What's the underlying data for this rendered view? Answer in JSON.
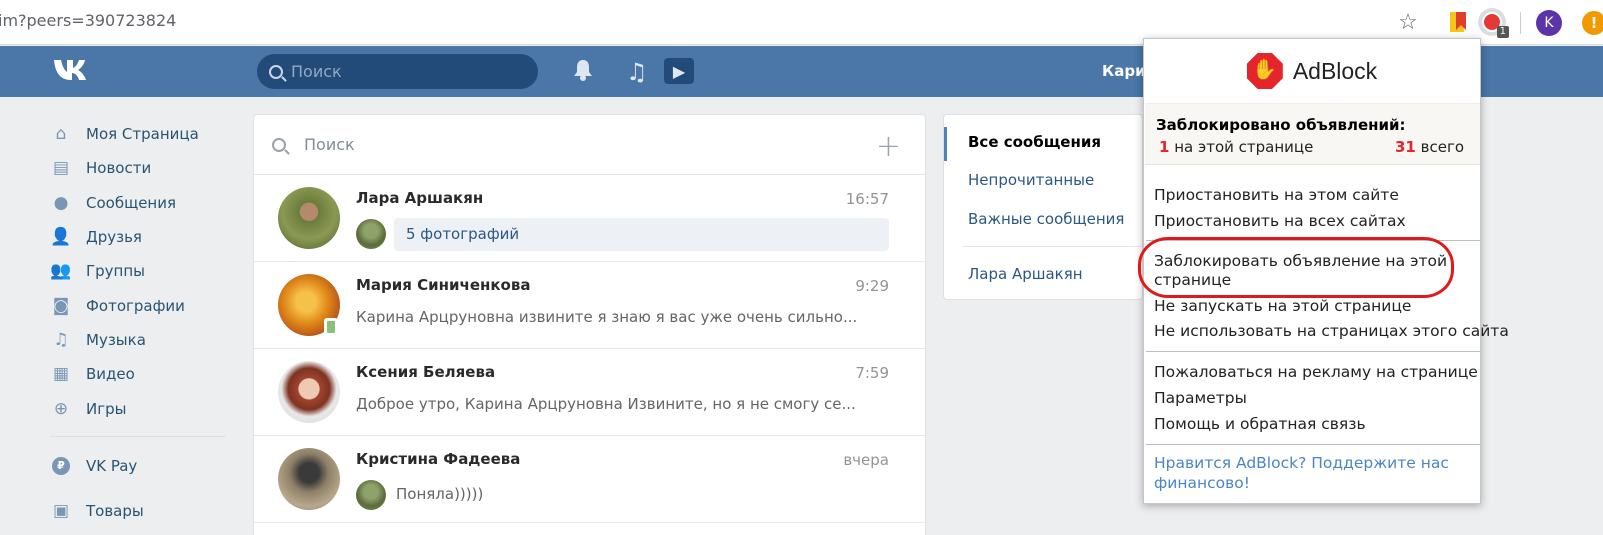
{
  "browser": {
    "url": "im?peers=390723824",
    "adblock_badge": "1",
    "profile_initial": "K",
    "alert_icon": "!"
  },
  "header": {
    "search_placeholder": "Поиск",
    "user_name": "Карин"
  },
  "left_menu": [
    {
      "label": "Моя Страница",
      "icon": "home-icon"
    },
    {
      "label": "Новости",
      "icon": "news-icon"
    },
    {
      "label": "Сообщения",
      "icon": "messages-icon"
    },
    {
      "label": "Друзья",
      "icon": "friends-icon"
    },
    {
      "label": "Группы",
      "icon": "groups-icon"
    },
    {
      "label": "Фотографии",
      "icon": "camera-icon"
    },
    {
      "label": "Музыка",
      "icon": "music-icon"
    },
    {
      "label": "Видео",
      "icon": "video-icon"
    },
    {
      "label": "Игры",
      "icon": "gamepad-icon"
    }
  ],
  "left_menu_extra": {
    "vkpay": "VK Pay",
    "vkpay_icon_letter": "₽",
    "goods": "Товары"
  },
  "dialogs": {
    "search_placeholder": "Поиск",
    "items": [
      {
        "name": "Лара Аршакян",
        "time": "16:57",
        "preview": "5 фотографий"
      },
      {
        "name": "Мария Синиченкова",
        "time": "9:29",
        "preview": "Карина Арцруновна извините я знаю я вас уже очень сильно..."
      },
      {
        "name": "Ксения Беляева",
        "time": "7:59",
        "preview": "Доброе утро, Карина Арцруновна Извините, но я не смогу се..."
      },
      {
        "name": "Кристина Фадеева",
        "time": "вчера",
        "preview": "Поняла)))))"
      }
    ]
  },
  "folders": {
    "all": "Все сообщения",
    "unread": "Непрочитанные",
    "important": "Важные сообщения",
    "contact": "Лара Аршакян"
  },
  "adblock": {
    "title": "AdBlock",
    "blocked_title": "Заблокировано объявлений:",
    "page_count": "1",
    "page_label": "на этой странице",
    "total_count": "31",
    "total_label": "всего",
    "pause_site": "Приостановить на этом сайте",
    "pause_all": "Приостановить на всех сайтах",
    "block_ad_line1": "Заблокировать объявление на этой",
    "block_ad_line2": "странице",
    "dont_run_page": "Не запускать на этой странице",
    "dont_use_site": "Не использовать на страницах этого сайта",
    "report_ad": "Пожаловаться на рекламу на странице",
    "options": "Параметры",
    "help": "Помощь и обратная связь",
    "support_line1": "Нравится AdBlock? Поддержите нас",
    "support_line2": "финансово!"
  },
  "colors": {
    "vk_blue": "#4a76a8",
    "link_blue": "#2a5885",
    "adblock_red": "#e4262c",
    "highlight_red": "#e01a1a"
  }
}
